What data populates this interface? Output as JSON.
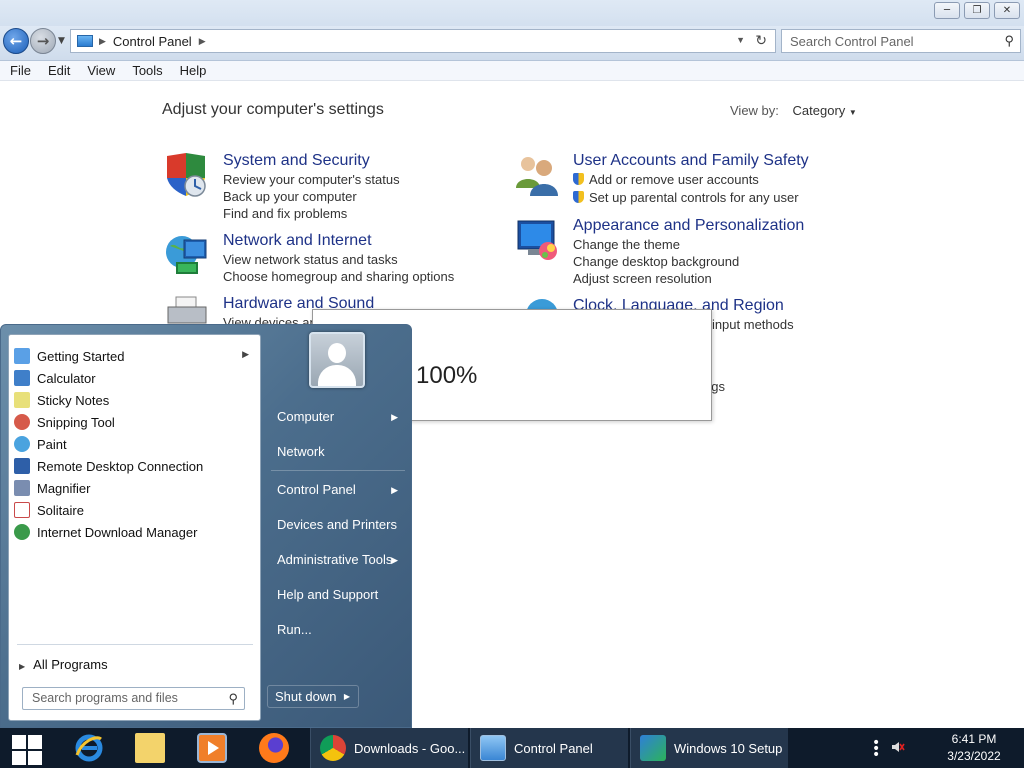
{
  "window": {
    "buttons": [
      "minimize",
      "restore",
      "close"
    ]
  },
  "address": {
    "location": "Control Panel",
    "search_placeholder": "Search Control Panel"
  },
  "menubar": [
    "File",
    "Edit",
    "View",
    "Tools",
    "Help"
  ],
  "control_panel": {
    "heading": "Adjust your computer's settings",
    "view_by_label": "View by:",
    "view_by_value": "Category",
    "categories": [
      {
        "title": "System and Security",
        "links": [
          "Review your computer's status",
          "Back up your computer",
          "Find and fix problems"
        ]
      },
      {
        "title": "Network and Internet",
        "links": [
          "View network status and tasks",
          "Choose homegroup and sharing options"
        ]
      },
      {
        "title": "Hardware and Sound",
        "links": [
          "View devices and"
        ]
      },
      {
        "title": "User Accounts and Family Safety",
        "links": [
          "Add or remove user accounts",
          "Set up parental controls for any user"
        ]
      },
      {
        "title": "Appearance and Personalization",
        "links": [
          "Change the theme",
          "Change desktop background",
          "Adjust screen resolution"
        ]
      },
      {
        "title": "Clock, Language, and Region",
        "links": [
          "r input methods",
          "ngs"
        ]
      }
    ]
  },
  "popup": {
    "title_fragment": "s",
    "status_fragment": "g 100%"
  },
  "start_menu": {
    "programs": [
      {
        "label": "Getting Started",
        "icon": "getting-started-icon",
        "color": "#5aa0e6",
        "submenu": true
      },
      {
        "label": "Calculator",
        "icon": "calculator-icon",
        "color": "#3f7fc9"
      },
      {
        "label": "Sticky Notes",
        "icon": "sticky-notes-icon",
        "color": "#e8e07a"
      },
      {
        "label": "Snipping Tool",
        "icon": "snipping-tool-icon",
        "color": "#d65a4a"
      },
      {
        "label": "Paint",
        "icon": "paint-icon",
        "color": "#4aa3df"
      },
      {
        "label": "Remote Desktop Connection",
        "icon": "remote-desktop-icon",
        "color": "#2e5fa8"
      },
      {
        "label": "Magnifier",
        "icon": "magnifier-icon",
        "color": "#7a8db0"
      },
      {
        "label": "Solitaire",
        "icon": "solitaire-icon",
        "color": "#c94a4a"
      },
      {
        "label": "Internet Download Manager",
        "icon": "idm-icon",
        "color": "#3a9a4a"
      }
    ],
    "all_programs": "All Programs",
    "search_placeholder": "Search programs and files",
    "right_items": [
      {
        "label": "Computer",
        "submenu": true
      },
      {
        "label": "Network",
        "submenu": false
      },
      {
        "label": "Control Panel",
        "submenu": true
      },
      {
        "label": "Devices and Printers",
        "submenu": false
      },
      {
        "label": "Administrative Tools",
        "submenu": true
      },
      {
        "label": "Help and Support",
        "submenu": false
      },
      {
        "label": "Run...",
        "submenu": false
      }
    ],
    "shutdown": "Shut down"
  },
  "taskbar": {
    "apps": [
      {
        "label": "Downloads - Goo...",
        "icon": "chrome-icon"
      },
      {
        "label": "Control Panel",
        "icon": "control-panel-icon"
      },
      {
        "label": "Windows 10 Setup",
        "icon": "windows-setup-icon"
      }
    ],
    "time": "6:41 PM",
    "date": "3/23/2022"
  }
}
